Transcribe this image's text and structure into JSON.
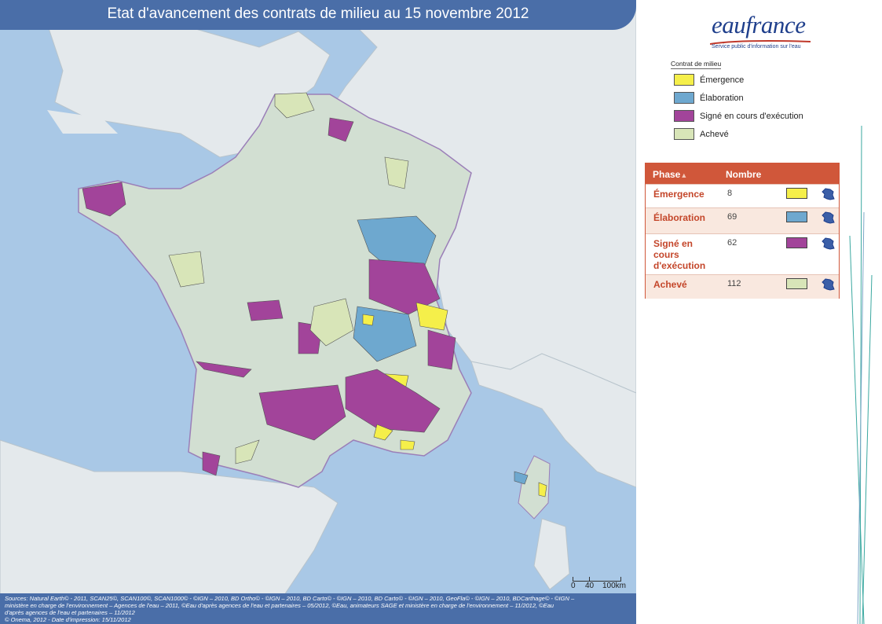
{
  "map": {
    "title": "Etat d'avancement des contrats de milieu au 15 novembre 2012",
    "sources": [
      "Sources: Natural Earth© - 2011, SCAN25©, SCAN100©, SCAN1000© - ©IGN – 2010, BD Ortho© - ©IGN – 2010, BD Carto© - ©IGN – 2010, BD Carto© - ©IGN – 2010, GeoFla© - ©IGN – 2010, BDCarthage© - ©IGN –",
      "ministère en charge de l'environnement – Agences de l'eau – 2011, ©Eau d'après agences de l'eau et partenaires – 05/2012, ©Eau, animateurs SAGE et ministère en charge de l'environnement – 11/2012, ©Eau",
      "d'après agences de l'eau et partenaires – 11/2012",
      "© Onema, 2012 - Date d'impression: 15/11/2012"
    ],
    "scale": {
      "ticks": [
        "0",
        "40",
        "100km"
      ]
    },
    "colors": {
      "sea": "#a9c8e6",
      "land": "#e4e9ec",
      "france": "#d2dfd2",
      "border": "#9b7fb8"
    }
  },
  "brand": {
    "name": "eaufrance",
    "tagline": "Service public d'information sur l'eau",
    "color": "#1f3f8c"
  },
  "legend": {
    "title": "Contrat de milieu",
    "items": [
      {
        "label": "Émergence",
        "color": "#f5ef4a"
      },
      {
        "label": "Élaboration",
        "color": "#6ea8cf"
      },
      {
        "label": "Signé en cours d'exécution",
        "color": "#a2449a"
      },
      {
        "label": "Achevé",
        "color": "#d8e5b8"
      }
    ]
  },
  "phase_table": {
    "header_phase": "Phase",
    "header_sort_icon": "sort-up-icon",
    "header_nombre": "Nombre",
    "rows": [
      {
        "phase": "Émergence",
        "count": "8",
        "color": "#f5ef4a",
        "icon": "france-map-icon"
      },
      {
        "phase": "Élaboration",
        "count": "69",
        "color": "#6ea8cf",
        "icon": "france-map-icon"
      },
      {
        "phase": "Signé en cours d'exécution",
        "count": "62",
        "color": "#a2449a",
        "icon": "france-map-icon"
      },
      {
        "phase": "Achevé",
        "count": "112",
        "color": "#d8e5b8",
        "icon": "france-map-icon"
      }
    ]
  }
}
